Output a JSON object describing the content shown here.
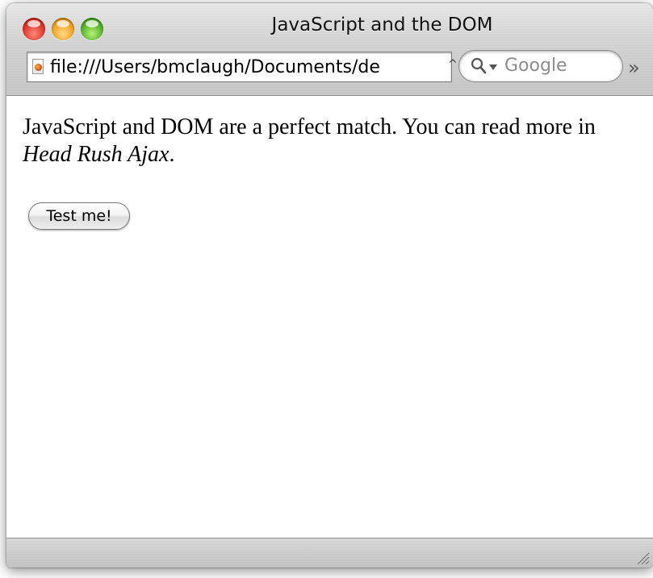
{
  "window": {
    "title": "JavaScript and the DOM"
  },
  "toolbar": {
    "url": "file:///Users/bmclaugh/Documents/de",
    "search_placeholder": "Google",
    "overflow_glyph": "»",
    "url_dropdown_glyph": "^"
  },
  "content": {
    "paragraph_part1": "JavaScript and DOM are a perfect match. You can read more in ",
    "book_title": "Head Rush Ajax",
    "paragraph_part2": ".",
    "button_label": "Test me!"
  },
  "icons": {
    "close": "close-button-icon",
    "minimize": "minimize-button-icon",
    "zoom": "zoom-button-icon",
    "page": "page-icon",
    "search": "search-icon",
    "resize": "resize-grip-icon"
  },
  "colors": {
    "close": "#e0332a",
    "minimize": "#f0a11e",
    "zoom": "#55b227",
    "chrome": "#d4d4d4"
  }
}
